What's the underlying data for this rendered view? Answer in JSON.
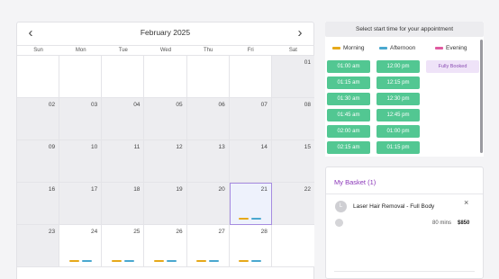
{
  "calendar": {
    "month_label": "February 2025",
    "prev_label": "‹",
    "next_label": "›",
    "weekdays": [
      "Sun",
      "Mon",
      "Tue",
      "Wed",
      "Thu",
      "Fri",
      "Sat"
    ],
    "weeks": [
      [
        {
          "day": "",
          "type": "empty"
        },
        {
          "day": "",
          "type": "empty"
        },
        {
          "day": "",
          "type": "empty"
        },
        {
          "day": "",
          "type": "empty"
        },
        {
          "day": "",
          "type": "empty"
        },
        {
          "day": "",
          "type": "empty"
        },
        {
          "day": "01",
          "type": "gray"
        }
      ],
      [
        {
          "day": "02",
          "type": "gray"
        },
        {
          "day": "03",
          "type": "gray"
        },
        {
          "day": "04",
          "type": "gray"
        },
        {
          "day": "05",
          "type": "gray"
        },
        {
          "day": "06",
          "type": "gray"
        },
        {
          "day": "07",
          "type": "gray"
        },
        {
          "day": "08",
          "type": "gray"
        }
      ],
      [
        {
          "day": "09",
          "type": "gray"
        },
        {
          "day": "10",
          "type": "gray"
        },
        {
          "day": "11",
          "type": "gray"
        },
        {
          "day": "12",
          "type": "gray"
        },
        {
          "day": "13",
          "type": "gray"
        },
        {
          "day": "14",
          "type": "gray"
        },
        {
          "day": "15",
          "type": "gray"
        }
      ],
      [
        {
          "day": "16",
          "type": "gray"
        },
        {
          "day": "17",
          "type": "gray"
        },
        {
          "day": "18",
          "type": "gray"
        },
        {
          "day": "19",
          "type": "gray"
        },
        {
          "day": "20",
          "type": "gray"
        },
        {
          "day": "21",
          "type": "selected",
          "marks": [
            "m",
            "a"
          ]
        },
        {
          "day": "22",
          "type": "gray"
        }
      ],
      [
        {
          "day": "23",
          "type": "gray"
        },
        {
          "day": "24",
          "type": "white",
          "marks": [
            "m",
            "a"
          ]
        },
        {
          "day": "25",
          "type": "white",
          "marks": [
            "m",
            "a"
          ]
        },
        {
          "day": "26",
          "type": "white",
          "marks": [
            "m",
            "a"
          ]
        },
        {
          "day": "27",
          "type": "white",
          "marks": [
            "m",
            "a"
          ]
        },
        {
          "day": "28",
          "type": "white",
          "marks": [
            "m",
            "a"
          ]
        },
        {
          "day": "",
          "type": "empty"
        }
      ]
    ]
  },
  "slots": {
    "title": "Select start time for your appointment",
    "legend": {
      "morning": "Morning",
      "afternoon": "Afternoon",
      "evening": "Evening"
    },
    "colors": {
      "morning": "#e6a91a",
      "afternoon": "#4aa8cf",
      "evening": "#e05aa0",
      "slot_bg": "#52c792"
    },
    "morning": [
      "01:00 am",
      "01:15 am",
      "01:30 am",
      "01:45 am",
      "02:00 am",
      "02:15 am"
    ],
    "afternoon": [
      "12:00 pm",
      "12:15 pm",
      "12:30 pm",
      "12:45 pm",
      "01:00 pm",
      "01:15 pm"
    ],
    "evening_status": "Fully Booked"
  },
  "basket": {
    "title": "My Basket (1)",
    "avatar_letter": "L",
    "item_name": "Laser Hair Removal - Full Body",
    "close_icon": "×",
    "duration": "80 mins",
    "price": "$850"
  }
}
